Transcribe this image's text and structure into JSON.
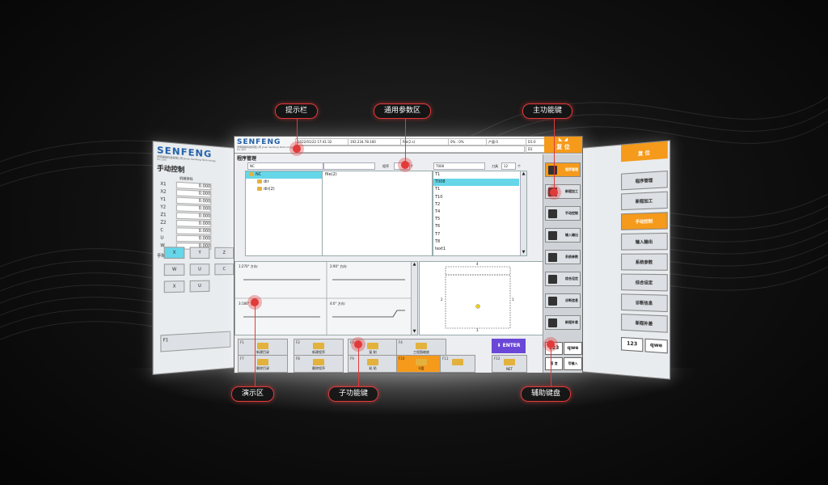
{
  "callouts": {
    "hint_bar": "提示栏",
    "common_params": "通用参数区",
    "main_function_keys": "主功能键",
    "demo_area": "演示区",
    "sub_function_keys": "子功能键",
    "aux_keyboard": "辅助键盘"
  },
  "brand": {
    "logo": "SENFENG",
    "subtitle": "济南森峰科技有限公司 Jinan Senfeng Technology Co.,Ltd"
  },
  "status": {
    "datetime": "2022/01/22 17:41:32",
    "ip": "192.234.78.160",
    "file": "file(2.s)",
    "ratio": "0% : 0%",
    "output_label": "产量:0",
    "zone": "D1:0",
    "zone2": "D1"
  },
  "reset_label": "复 位",
  "program": {
    "title": "程序管理",
    "path": "NC",
    "tree": [
      {
        "name": "NC",
        "selected": true
      },
      {
        "name": "dir",
        "selected": false
      },
      {
        "name": "dir(2)",
        "selected": false
      }
    ],
    "files": [
      "file(2)"
    ],
    "program_label": "程序",
    "program_unit": "个",
    "tool_field": "T008",
    "tool_label": "刀具",
    "tool_count": "12",
    "tool_unit": "个",
    "tools": [
      "T1",
      "T008",
      "T1",
      "T10",
      "T2",
      "T4",
      "T5",
      "T6",
      "T7",
      "T8",
      "text1"
    ],
    "selected_tool_index": 1
  },
  "demo": {
    "cells": [
      "1:270° 方向:",
      "2:90° 方向:",
      "3:180° 方向:",
      "4:0° 方向:"
    ],
    "sheet_top": "4",
    "sheet_left": "2",
    "sheet_right": "1",
    "sheet_bottom": "3"
  },
  "fkeys": [
    {
      "num": "F1",
      "label": "新建目录"
    },
    {
      "num": "F2",
      "label": "新建程序"
    },
    {
      "num": "F3",
      "label": "复 制"
    },
    {
      "num": "F4",
      "label": "工程图缩放"
    },
    {
      "num": "F7",
      "label": "删除目录"
    },
    {
      "num": "F8",
      "label": "删除程序"
    },
    {
      "num": "F9",
      "label": "粘 贴"
    },
    {
      "num": "F10",
      "label": "U盘"
    },
    {
      "num": "F11",
      "label": ""
    },
    {
      "num": "F12",
      "label": "NET"
    }
  ],
  "enter_label": "ENTER",
  "menu": [
    {
      "label": "程序管理",
      "active": true
    },
    {
      "label": "新程加工",
      "active": false
    },
    {
      "label": "手动控制",
      "active": false
    },
    {
      "label": "输入输出",
      "active": false
    },
    {
      "label": "系统参数",
      "active": false
    },
    {
      "label": "综合设定",
      "active": false
    },
    {
      "label": "诊断信息",
      "active": false
    },
    {
      "label": "新程补差",
      "active": false
    }
  ],
  "keyboard": {
    "num": "123",
    "alpha": "qwe",
    "lang": "语 言",
    "input": "写输入"
  },
  "left_screen": {
    "logo": "SENFENG",
    "title": "手动控制",
    "col": "机械坐标",
    "axes": [
      {
        "name": "X1",
        "value": "0.000"
      },
      {
        "name": "X2",
        "value": "0.000"
      },
      {
        "name": "Y1",
        "value": "0.000"
      },
      {
        "name": "Y2",
        "value": "0.000"
      },
      {
        "name": "Z1",
        "value": "0.000"
      },
      {
        "name": "Z2",
        "value": "0.000"
      },
      {
        "name": "C",
        "value": "0.000"
      },
      {
        "name": "U",
        "value": "0.000"
      },
      {
        "name": "W",
        "value": "0.000"
      }
    ],
    "section": "手轮",
    "buttons": [
      "X",
      "Y",
      "Z",
      "W",
      "U",
      "C"
    ],
    "fkey": "F1"
  },
  "right_screen": {
    "reset": "复 位",
    "menu": [
      "程序管理",
      "新程加工",
      "手动控制",
      "输入输出",
      "系统参数",
      "综合设定",
      "诊断信息",
      "新程补差"
    ],
    "active_index": 2
  },
  "colors": {
    "accent": "#f59a1b",
    "select": "#66d6e8",
    "brand": "#1f5fa8",
    "enter": "#6a47d6",
    "callout": "#e23a3a"
  }
}
